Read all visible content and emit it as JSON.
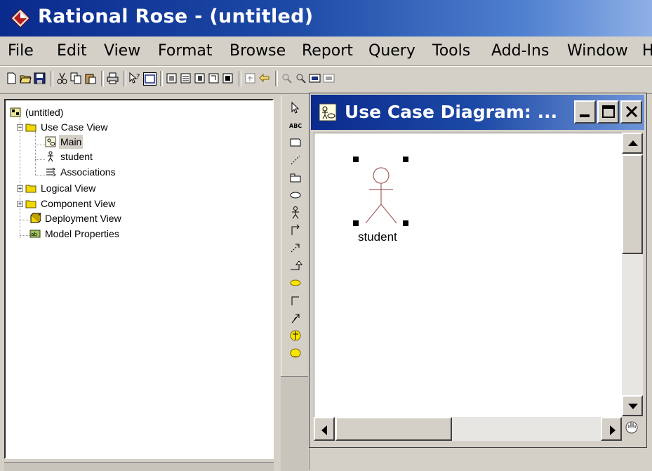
{
  "window": {
    "title": "Rational Rose - (untitled)"
  },
  "menu": [
    {
      "label": "File",
      "name": "menu-file"
    },
    {
      "label": "Edit",
      "name": "menu-edit"
    },
    {
      "label": "View",
      "name": "menu-view"
    },
    {
      "label": "Format",
      "name": "menu-format"
    },
    {
      "label": "Browse",
      "name": "menu-browse"
    },
    {
      "label": "Report",
      "name": "menu-report"
    },
    {
      "label": "Query",
      "name": "menu-query"
    },
    {
      "label": "Tools",
      "name": "menu-tools"
    },
    {
      "label": "Add-Ins",
      "name": "menu-add-ins"
    },
    {
      "label": "Window",
      "name": "menu-window"
    },
    {
      "label": "H",
      "name": "menu-help"
    }
  ],
  "toolbar": {
    "buttons": [
      "new-icon",
      "open-icon",
      "save-icon",
      "cut-icon",
      "copy-icon",
      "paste-icon",
      "print-icon",
      "context-help-icon",
      "view-doc-icon",
      "browse-class-diagram-icon",
      "browse-interaction-diagram-icon",
      "browse-component-diagram-icon",
      "browse-deployment-diagram-icon",
      "browse-parent-icon",
      "browse-previous-diagram-icon",
      "zoom-in-icon",
      "zoom-out-icon",
      "fit-in-window-icon",
      "undo-fit-icon"
    ]
  },
  "browser": {
    "root": "(untitled)",
    "use_case_view": "Use Case View",
    "main": "Main",
    "student": "student",
    "associations": "Associations",
    "logical_view": "Logical View",
    "component_view": "Component View",
    "deployment_view": "Deployment View",
    "model_properties": "Model Properties"
  },
  "palette": {
    "tools": [
      "selection-tool-icon",
      "text-box-icon",
      "note-icon",
      "anchor-note-icon",
      "package-icon",
      "use-case-icon",
      "actor-icon",
      "unidirectional-association-icon",
      "dependency-icon",
      "generalization-icon",
      "yellow-use-case-icon",
      "association-icon",
      "directed-association-icon",
      "business-actor-icon",
      "business-use-case-icon"
    ]
  },
  "diagram": {
    "title": "Use Case Diagram: ...",
    "actor": {
      "label": "student"
    }
  },
  "colors": {
    "title_bar": "#0a2a8e",
    "folder_yellow": "#f0d800",
    "window_face": "#d4d0c8"
  }
}
